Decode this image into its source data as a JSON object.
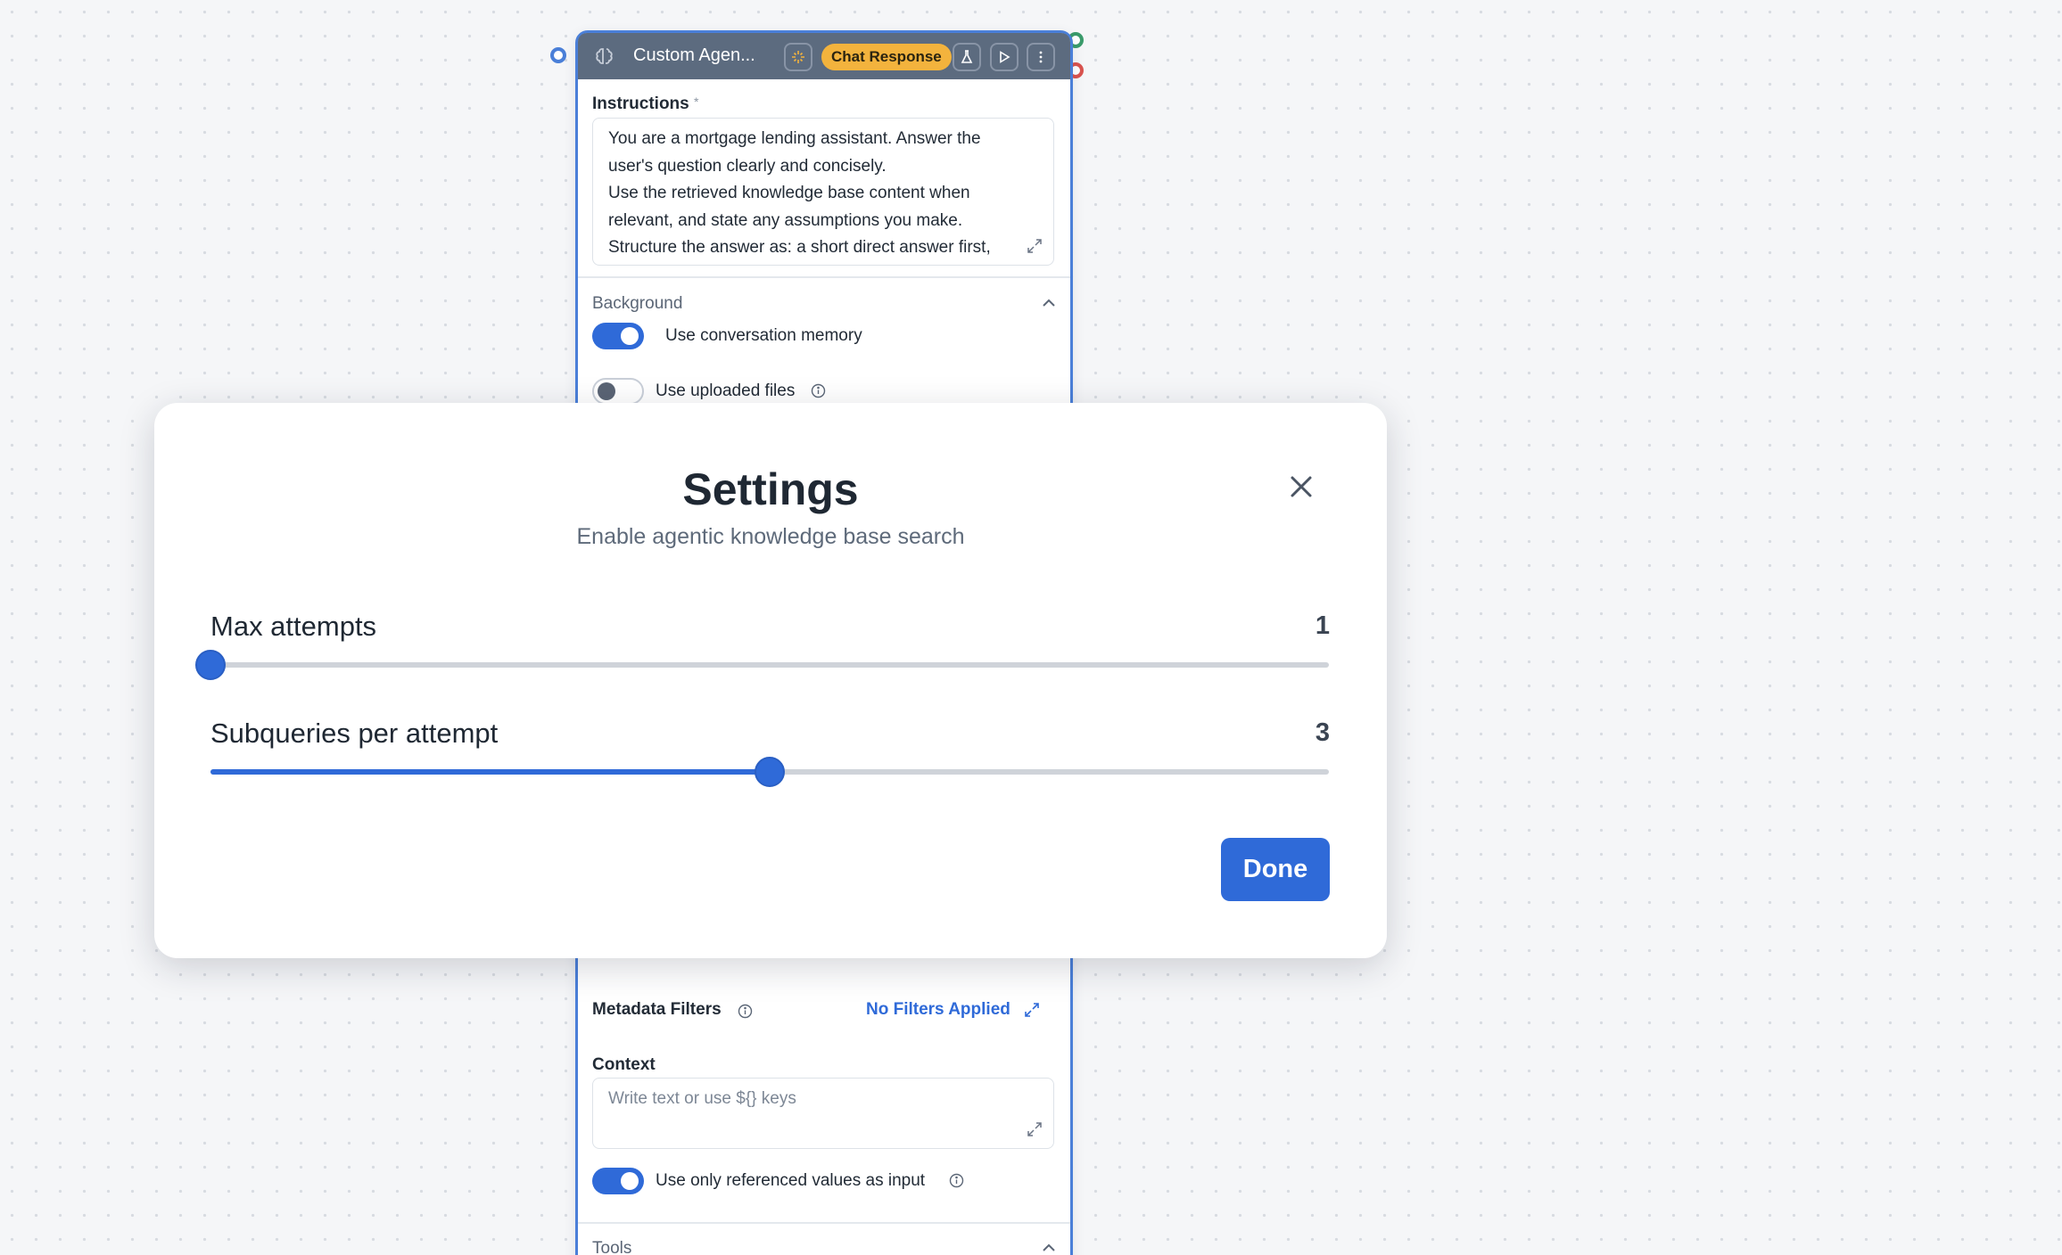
{
  "node": {
    "title": "Custom Agen...",
    "badge": "Chat Response",
    "instructions": {
      "label": "Instructions",
      "required_mark": "*",
      "lines": [
        "You are a mortgage lending assistant. Answer the",
        "user's question clearly and concisely.",
        "Use the retrieved knowledge base content when",
        "relevant, and state any assumptions you make.",
        "Structure the answer as: a short direct answer first,"
      ]
    },
    "background": {
      "title": "Background",
      "use_memory_label": "Use conversation memory",
      "use_memory_on": true,
      "use_files_label": "Use uploaded files",
      "use_files_on": false
    },
    "metadata": {
      "label": "Metadata Filters",
      "value": "No Filters Applied"
    },
    "context": {
      "label": "Context",
      "placeholder": "Write text or use ${} keys"
    },
    "referenced": {
      "label": "Use only referenced values as input",
      "on": true
    },
    "tools": {
      "title": "Tools"
    }
  },
  "modal": {
    "title": "Settings",
    "subtitle": "Enable agentic knowledge base search",
    "sliders": [
      {
        "label": "Max attempts",
        "value": "1",
        "fraction": 0.0
      },
      {
        "label": "Subqueries per attempt",
        "value": "3",
        "fraction": 0.5
      }
    ],
    "done_label": "Done"
  },
  "colors": {
    "accent": "#2f6ad8",
    "badge": "#f3b33d",
    "header": "#5c6b7f",
    "port_green": "#3a9b6b",
    "port_red": "#d9534f"
  }
}
